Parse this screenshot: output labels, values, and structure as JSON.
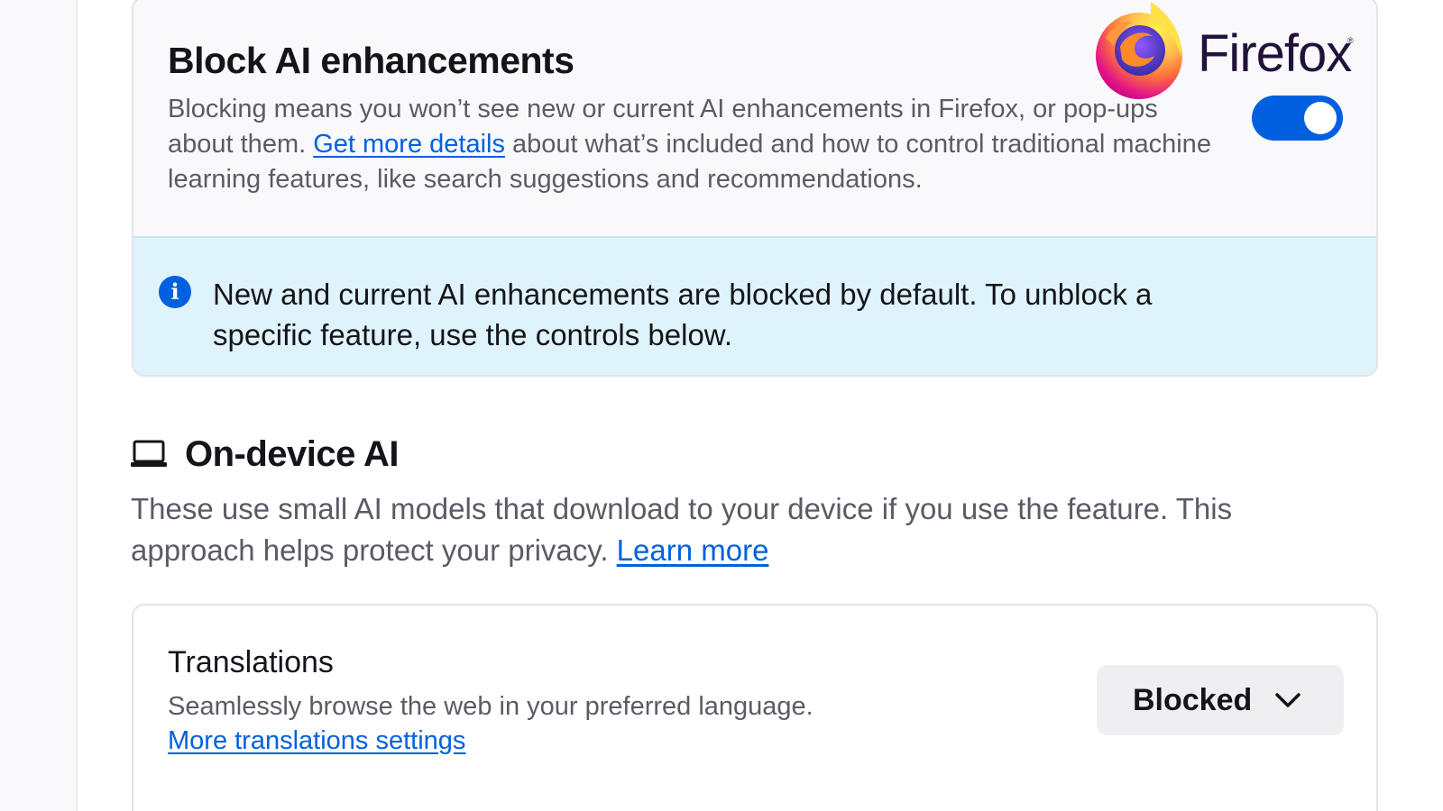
{
  "block_card": {
    "title": "Block AI enhancements",
    "desc_before": "Blocking means you won’t see new or current AI enhancements in Firefox, or pop-ups about them. ",
    "desc_link": "Get more details",
    "desc_after": " about what’s included and how to control traditional machine learning features, like search suggestions and recommendations.",
    "toggle_on": true
  },
  "info_bar": {
    "icon": "info-icon",
    "text": "New and current AI enhancements are blocked by default. To unblock a specific feature, use the controls below."
  },
  "branding": {
    "wordmark": "Firefox",
    "registered": "®"
  },
  "on_device": {
    "icon": "laptop-icon",
    "title": "On-device AI",
    "desc": "These use small AI models that download to your device if you use the feature. This approach helps protect your privacy. ",
    "learn_more": "Learn more"
  },
  "translations": {
    "title": "Translations",
    "desc": "Seamlessly browse the web in your preferred language.",
    "link": "More translations settings",
    "select_value": "Blocked",
    "select_icon": "chevron-down-icon"
  },
  "colors": {
    "accent": "#0060df",
    "link": "#0061e0",
    "info_bg": "#def3fb"
  }
}
